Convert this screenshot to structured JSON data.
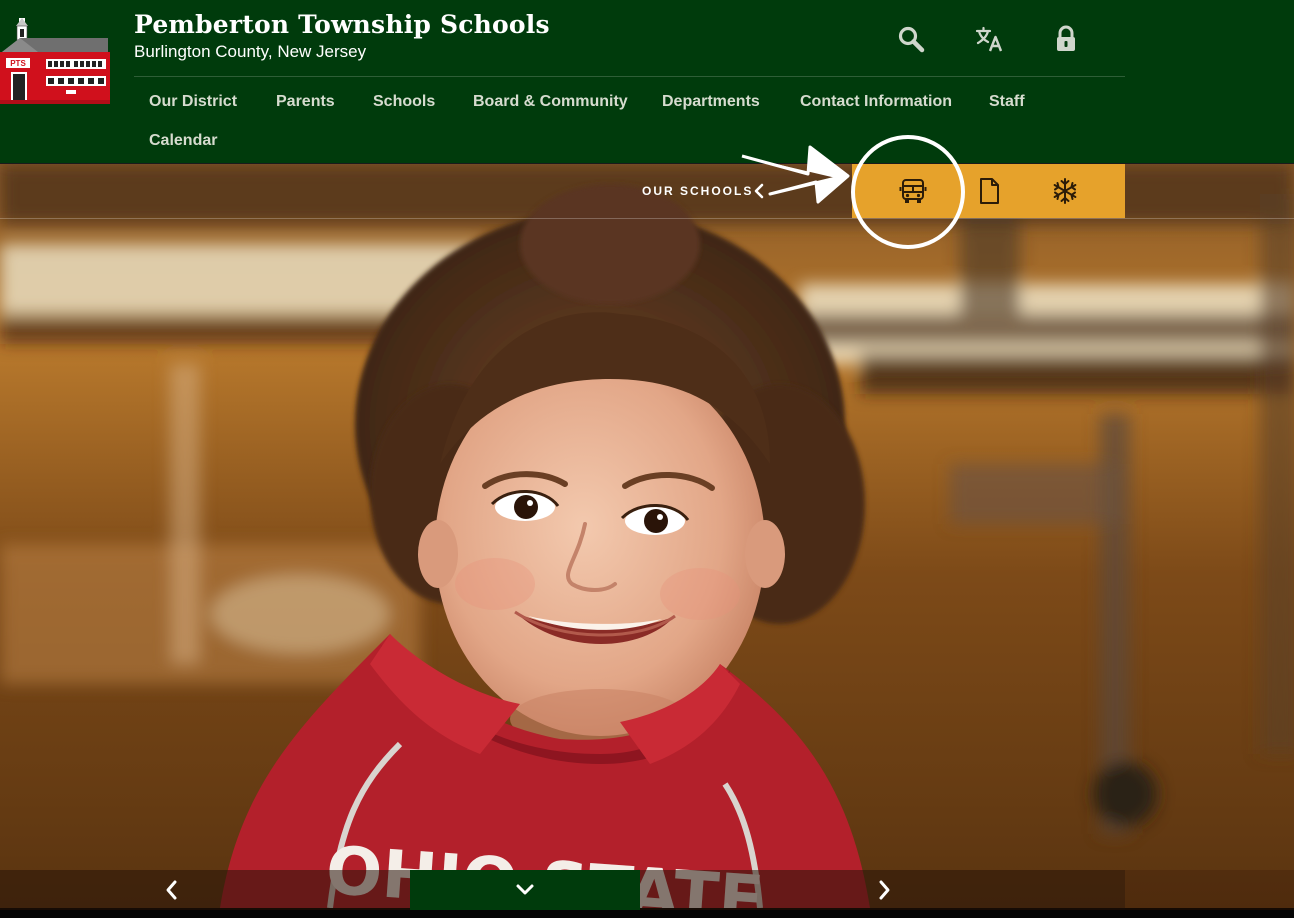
{
  "header": {
    "title": "Pemberton Township Schools",
    "subtitle": "Burlington County, New Jersey",
    "logo_text": "PTS",
    "utility_icons": [
      "search-icon",
      "translate-icon",
      "lock-icon"
    ]
  },
  "nav": {
    "items": [
      {
        "label": "Our District"
      },
      {
        "label": "Parents"
      },
      {
        "label": "Schools"
      },
      {
        "label": "Board & Community"
      },
      {
        "label": "Departments"
      },
      {
        "label": "Contact Information"
      },
      {
        "label": "Staff"
      },
      {
        "label": "Calendar"
      }
    ]
  },
  "hero": {
    "our_schools_label": "OUR SCHOOLS",
    "quicklinks": [
      "bus-icon",
      "document-icon",
      "snowflake-icon"
    ],
    "shirt_text": "OHIO STATE"
  },
  "slider": {
    "controls": [
      "chevron-left-icon",
      "chevron-down-icon",
      "chevron-right-icon"
    ]
  },
  "colors": {
    "header_bg": "#003b0c",
    "accent_gold": "#e6a22b",
    "nav_text": "#d6dccf",
    "logo_red": "#d0101c"
  }
}
